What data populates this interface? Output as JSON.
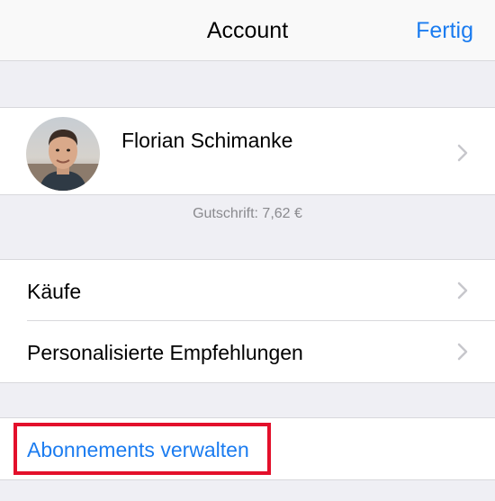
{
  "nav": {
    "title": "Account",
    "done_label": "Fertig"
  },
  "profile": {
    "name": "Florian Schimanke"
  },
  "credit": {
    "text": "Gutschrift: 7,62 €"
  },
  "menu": {
    "items": [
      {
        "label": "Käufe"
      },
      {
        "label": "Personalisierte Empfehlungen"
      }
    ]
  },
  "subscriptions": {
    "label": "Abonnements verwalten"
  },
  "colors": {
    "accent": "#1b7cf0",
    "highlight": "#e3102b",
    "background": "#efeff4"
  }
}
